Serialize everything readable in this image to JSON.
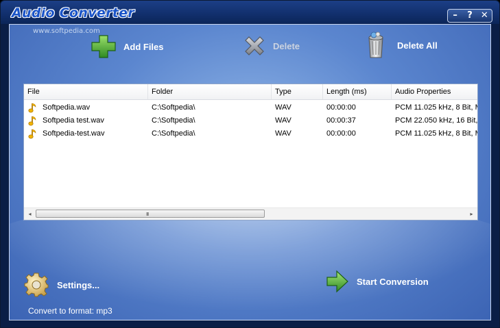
{
  "window": {
    "title": "Audio Converter",
    "controls": {
      "minimize": "–",
      "help": "?",
      "close": "✕"
    }
  },
  "watermark": "www.softpedia.com",
  "toolbar": {
    "add_files": "Add Files",
    "delete": "Delete",
    "delete_all": "Delete All"
  },
  "file_list": {
    "columns": [
      "File",
      "Folder",
      "Type",
      "Length (ms)",
      "Audio Properties"
    ],
    "rows": [
      {
        "file": "Softpedia.wav",
        "folder": "C:\\Softpedia\\",
        "type": "WAV",
        "length": "00:00:00",
        "props": "PCM 11.025 kHz, 8 Bit, M"
      },
      {
        "file": "Softpedia test.wav",
        "folder": "C:\\Softpedia\\",
        "type": "WAV",
        "length": "00:00:37",
        "props": "PCM 22.050 kHz, 16 Bit, "
      },
      {
        "file": "Softpedia-test.wav",
        "folder": "C:\\Softpedia\\",
        "type": "WAV",
        "length": "00:00:00",
        "props": "PCM 11.025 kHz, 8 Bit, M"
      }
    ],
    "scrollbar": {
      "left_arrow": "◂",
      "right_arrow": "▸",
      "grip": "III"
    }
  },
  "settings_label": "Settings...",
  "start_label": "Start Conversion",
  "status_text": "Convert to format: mp3",
  "colors": {
    "title_blue": "#1a54c8",
    "accent_green": "#3aa13a"
  }
}
